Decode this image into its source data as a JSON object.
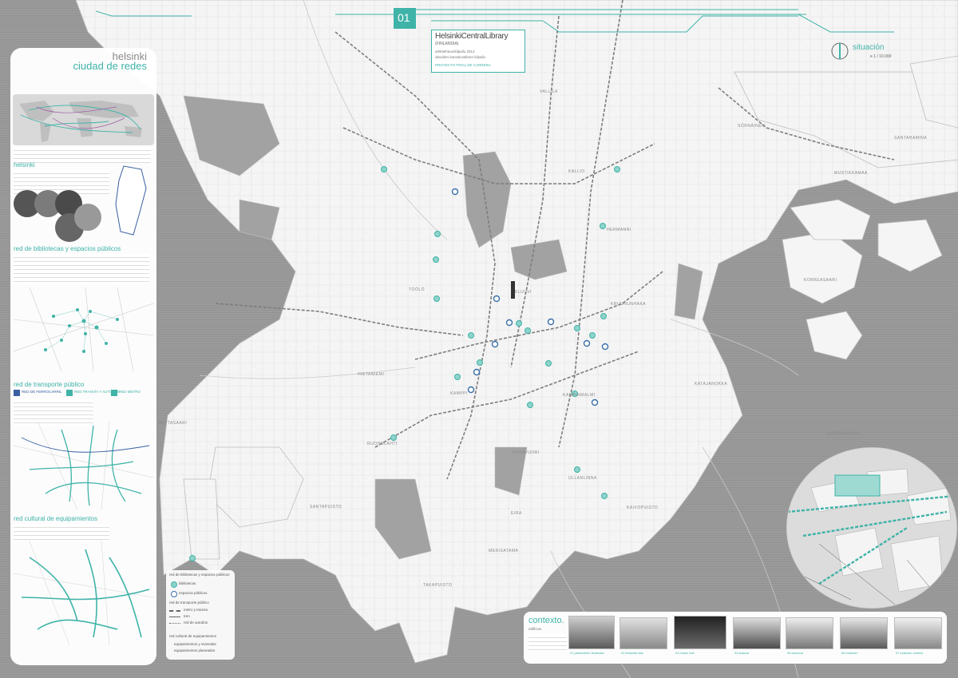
{
  "header": {
    "sheet_number": "01",
    "title": "HelsinkiCentralLibrary",
    "subtitle": "(FINLANDIA)",
    "line1": "arkkitehtuurikilpailu 2012",
    "line2": "ideoiden kansainvälinen kilpailu",
    "line3": "PROYECTO FINAL DE CARRERA"
  },
  "situation": {
    "label": "situación",
    "scale": "e 1 / 10.000"
  },
  "sidebar": {
    "title_line1": "helsinki",
    "title_line2": "ciudad de redes",
    "sec_helsinki": "helsinki",
    "sec_bibliotecas": "red de bibliotecas y espacios públicos",
    "sec_transporte": "red de transporte público",
    "sec_equipamientos": "red cultural de equipamientos",
    "legend_metro": "RED DE FERROCARRIL",
    "legend_tranvia": "RED TRANVÍA Y AUTOBÚS",
    "legend_metro2": "RED METRO"
  },
  "districts": [
    "LAUTTASAARI",
    "RUOHOLAHTI",
    "KAMPPI",
    "PUNAVUORI",
    "EIRA",
    "ULLANLINNA",
    "KAIVOPUISTO",
    "KRUUNUNHAKA",
    "KATAJANOKKA",
    "KORKEASAARI",
    "MUSTIKKAMAA",
    "SÖRNÄINEN",
    "KALLIO",
    "TÖÖLÖ",
    "KLUUVI",
    "SANTAHAMINA",
    "HERMANNI",
    "VALLILA",
    "SUOMENLINNA",
    "HIETANIEMI",
    "SANTAPUISTO",
    "MERISATAMA",
    "TAKAPUISTO",
    "KAMPINMALMI"
  ],
  "map_legend": {
    "title": "red de bibliotecas y espacios públicos",
    "item1": "bibliotecas",
    "item2": "espacios públicos",
    "sub_title": "red de transporte público",
    "item3": "metro y tranvía",
    "item4": "tren",
    "item5": "red de autobús",
    "eq_title": "red cultural de equipamientos",
    "item6": "equipamientos y viviendas",
    "item7": "equipamientos planeados"
  },
  "context": {
    "title": "contexto.",
    "subtitle": "edificios",
    "captions": [
      "01 parlamento finlandés",
      "02 finlandia talo",
      "03 music hall",
      "04 kiasma",
      "05 sanoma",
      "06 estación",
      "07 estación central"
    ]
  },
  "colors": {
    "accent": "#3fb3a8",
    "water": "#9a9a9a",
    "land": "#f4f4f4"
  }
}
